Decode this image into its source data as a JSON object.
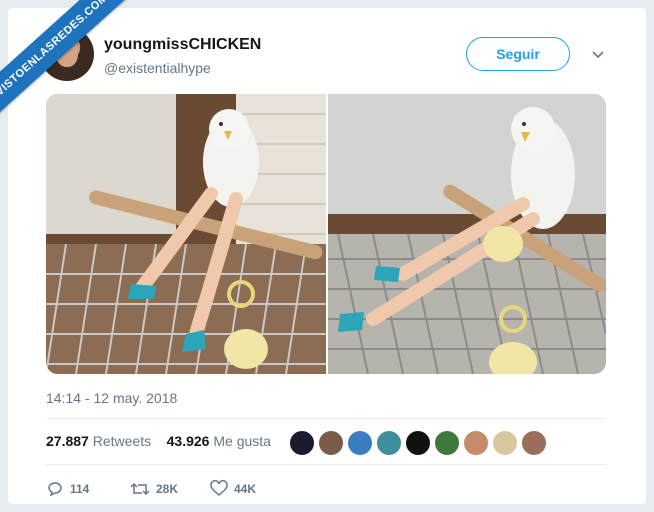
{
  "watermark": {
    "text": "VISTOENLASREDES.COM"
  },
  "author": {
    "name": "youngmissCHICKEN",
    "handle": "@existentialhype"
  },
  "follow_label": "Seguir",
  "timestamp": "14:14 - 12 may. 2018",
  "stats": {
    "retweets_count": "27.887",
    "retweets_label": "Retweets",
    "likes_count": "43.926",
    "likes_label": "Me gusta"
  },
  "actions": {
    "replies": "114",
    "retweets": "28K",
    "likes": "44K"
  },
  "colors": {
    "accent": "#1da1f2",
    "ribbon": "#1e73be",
    "muted": "#657786"
  },
  "icons": [
    "chevron-down-icon",
    "reply-icon",
    "retweet-icon",
    "heart-icon"
  ]
}
